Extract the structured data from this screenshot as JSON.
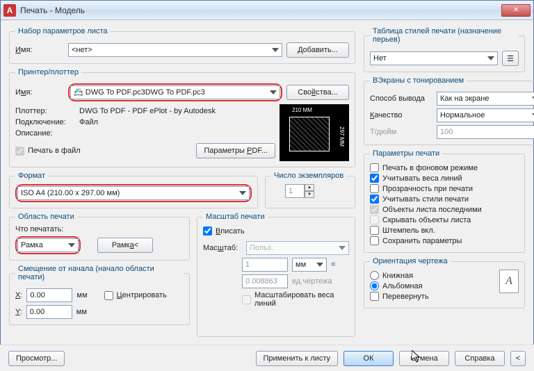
{
  "title": "Печать - Модель",
  "pageSetup": {
    "legend": "Набор параметров листа",
    "nameLabel": "Имя:",
    "nameValue": "<нет>",
    "addBtn": "Добавить..."
  },
  "printer": {
    "legend": "Принтер/плоттер",
    "nameLabel": "Имя:",
    "nameValue": "DWG To PDF.pc3",
    "propsBtn": "Свойства...",
    "plotterLabel": "Плоттер:",
    "plotterValue": "DWG To PDF - PDF ePlot - by Autodesk",
    "connLabel": "Подключение:",
    "connValue": "Файл",
    "descLabel": "Описание:",
    "toFile": "Печать в файл",
    "pdfParams": "Параметры PDF...",
    "previewTop": "210 MM",
    "previewSide": "297 MM"
  },
  "paper": {
    "legend": "Формат",
    "value": "ISO A4 (210.00 x 297.00 мм)",
    "copiesLabel": "Число экземпляров",
    "copiesValue": "1"
  },
  "area": {
    "legend": "Область печати",
    "whatLabel": "Что печатать:",
    "whatValue": "Рамка",
    "windowBtn": "Рамка<"
  },
  "offset": {
    "legend": "Смещение от начала (начало области печати)",
    "xLabel": "X:",
    "xValue": "0.00",
    "yLabel": "Y:",
    "yValue": "0.00",
    "unit": "мм",
    "center": "Центрировать"
  },
  "scale": {
    "legend": "Масштаб печати",
    "fit": "Вписать",
    "scaleLabel": "Масштаб:",
    "scaleValue": "Польз.",
    "num": "1",
    "numUnit": "мм",
    "den": "0.008863",
    "denUnit": "ед.чертежа",
    "lw": "Масштабировать веса линий"
  },
  "styles": {
    "legend": "Таблица стилей печати (назначение перьев)",
    "value": "Нет"
  },
  "shade": {
    "legend": "ВЭкраны с тонированием",
    "modeLabel": "Способ вывода",
    "modeValue": "Как на экране",
    "qualLabel": "Качество",
    "qualValue": "Нормальное",
    "dpiLabel": "Т/дюйм",
    "dpiValue": "100"
  },
  "opts": {
    "legend": "Параметры печати",
    "bg": "Печать в фоновом режиме",
    "lw": "Учитывать веса линий",
    "tr": "Прозрачность при печати",
    "st": "Учитывать стили печати",
    "last": "Объекты листа последними",
    "hide": "Скрывать объекты листа",
    "stamp": "Штемпель вкл.",
    "save": "Сохранить параметры"
  },
  "orient": {
    "legend": "Ориентация чертежа",
    "portrait": "Книжная",
    "landscape": "Альбомная",
    "upside": "Перевернуть",
    "iconLetter": "A"
  },
  "footer": {
    "preview": "Просмотр...",
    "apply": "Применить к листу",
    "ok": "ОК",
    "cancel": "Отмена",
    "help": "Справка"
  }
}
